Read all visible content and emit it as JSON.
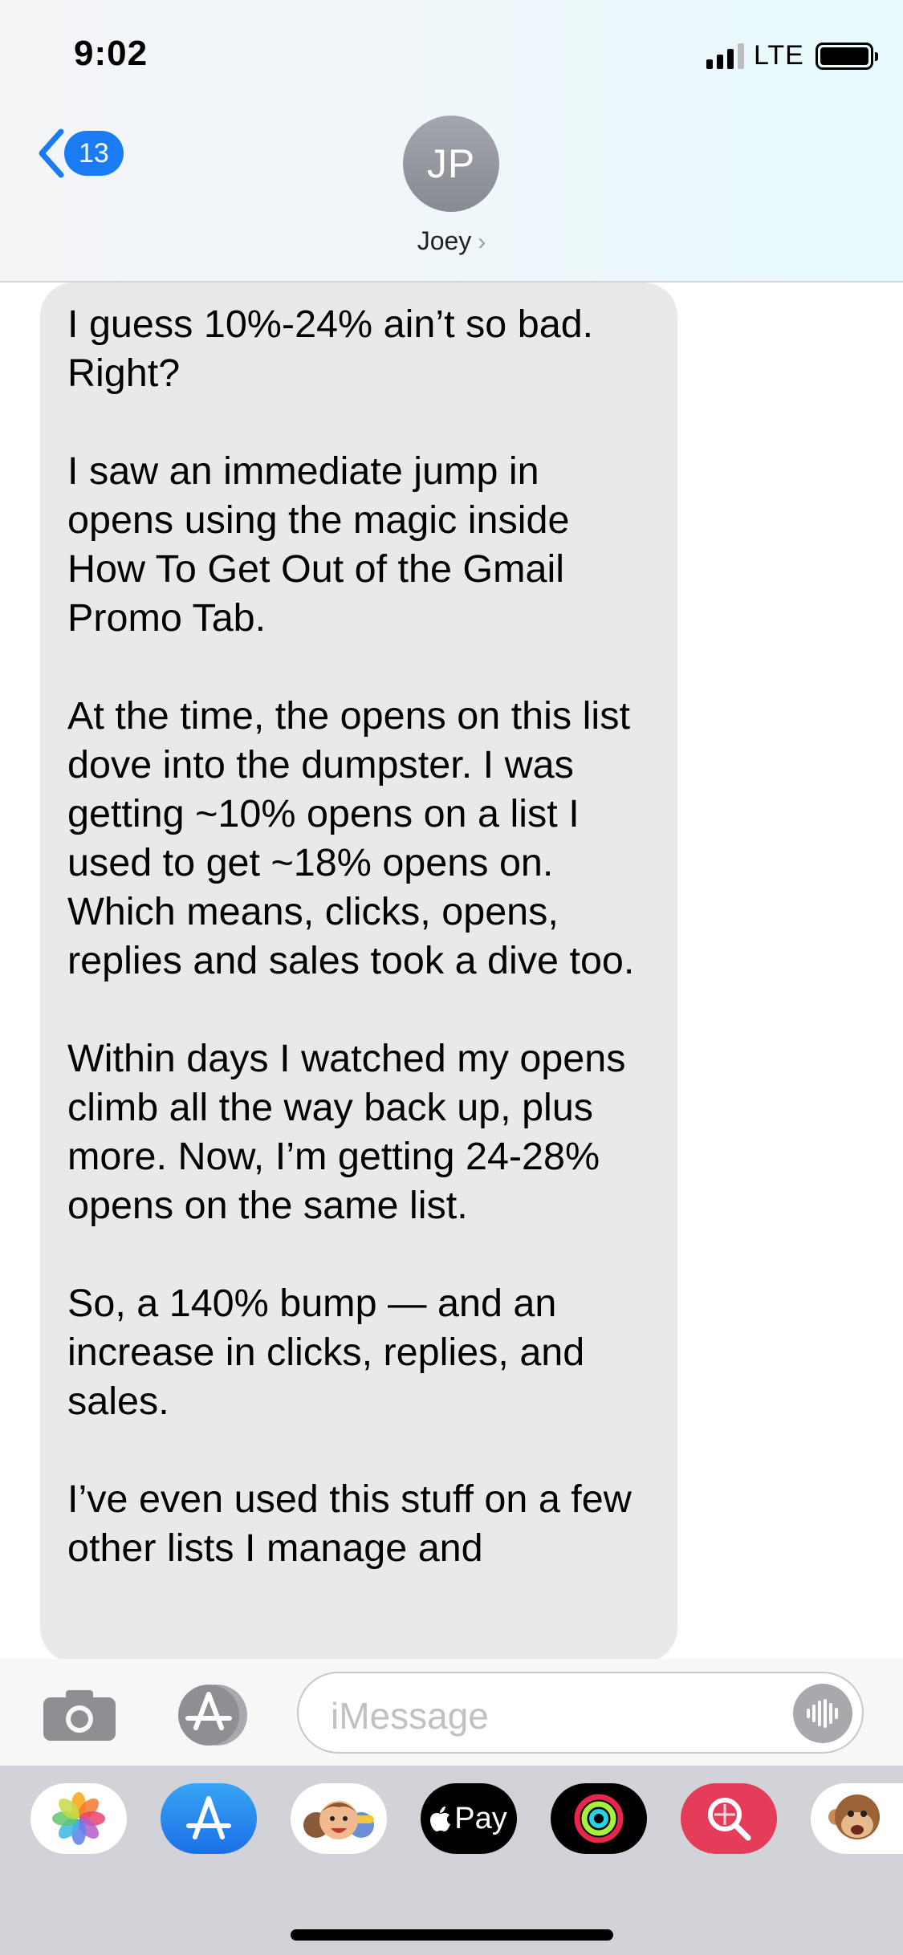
{
  "status_bar": {
    "time": "9:02",
    "network": "LTE"
  },
  "nav": {
    "back_count": "13",
    "avatar_initials": "JP",
    "contact_name": "Joey"
  },
  "message": {
    "paragraphs": [
      "I guess 10%-24% ain’t so bad. Right?",
      "I saw an immediate jump in opens using the magic inside How To Get Out of the Gmail Promo Tab.",
      "At the time, the opens on this list dove into the dumpster. I was getting ~10% opens on a list I used to get ~18% opens on. Which means, clicks, opens, replies and sales took a dive too.",
      "Within days I watched my opens climb all the way back up, plus more. Now, I’m getting 24-28% opens on the same list.",
      "So, a 140% bump — and an increase in clicks, replies, and sales.",
      "I’ve even used this stuff on a few other lists I manage and"
    ]
  },
  "input": {
    "placeholder": "iMessage"
  },
  "app_drawer": {
    "apps": [
      {
        "icon": "photos-icon"
      },
      {
        "icon": "app-store-icon"
      },
      {
        "icon": "memoji-icon"
      },
      {
        "icon": "apple-pay-icon",
        "label": "Pay"
      },
      {
        "icon": "activity-icon"
      },
      {
        "icon": "search-images-icon"
      },
      {
        "icon": "animoji-icon"
      }
    ]
  },
  "colors": {
    "accent": "#1a7cf5",
    "bubble": "#e9e9eb",
    "drawer": "#d1d3d8"
  }
}
